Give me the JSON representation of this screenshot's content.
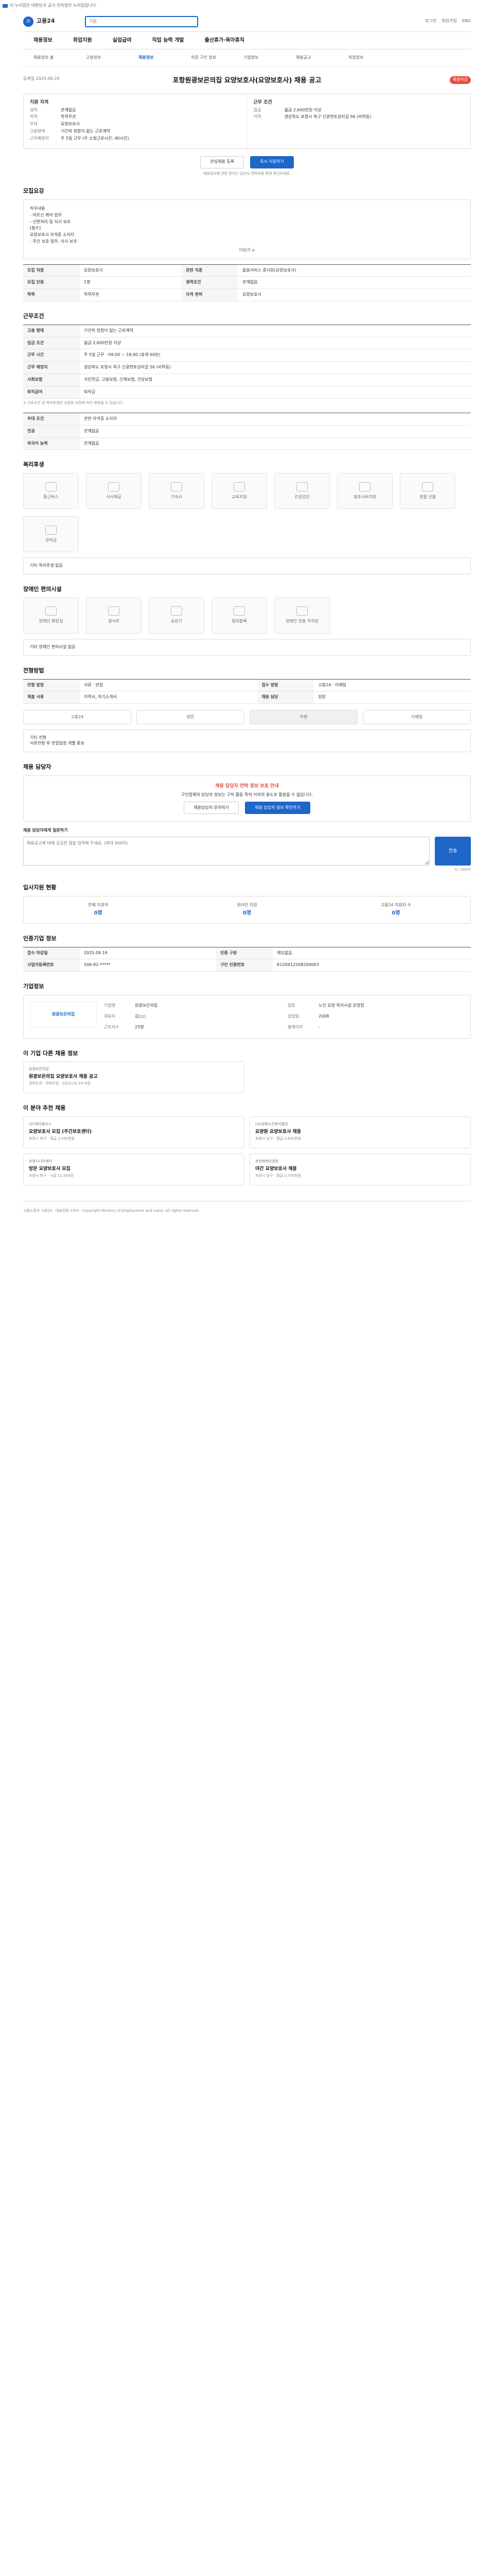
{
  "topbar": {
    "notice": "이 누리집은 대한민국 공식 전자정부 누리집입니다."
  },
  "brand": {
    "logo_text": "고용24",
    "search_placeholder": "기업",
    "util": [
      "로그인",
      "회원가입",
      "ENG"
    ]
  },
  "gnb": [
    "채용정보",
    "취업지원",
    "실업급여",
    "직업 능력 개발",
    "출산휴가·육아휴직"
  ],
  "sub": [
    "채용정보 홈",
    "고용정보",
    "채용정보",
    "직종 구인 정보",
    "기업정보",
    "채용공고",
    "직업정보"
  ],
  "job": {
    "title": "포항원광보은의집 요양보호사(요양보호사) 채용 공고",
    "registered": "등록일 2025.08.20",
    "badge": "채용마감",
    "recruit_title": "지원 자격",
    "work_title": "근무 조건",
    "recruit": [
      {
        "k": "경력",
        "v": "관계없음"
      },
      {
        "k": "학력",
        "v": "학력무관"
      },
      {
        "k": "우대",
        "v": "요양보호사"
      },
      {
        "k": "고용형태",
        "v": "기간의 정함이 없는 근로계약"
      },
      {
        "k": "근무예정지",
        "v": "주 5일 근무 (주 소정근로시간: 40시간)"
      }
    ],
    "work": [
      {
        "k": "임금",
        "v": "월급 2,600천원 이상"
      },
      {
        "k": "지역",
        "v": "경상북도 포항시 북구 신광면토성리길 56 (비학동)"
      }
    ],
    "apply_btn": "즉시 지원하기",
    "scrap_btn": "관심채용 등록",
    "hint": "채용정보에 관한 문의는 담당자 연락처를 통해 확인하세요."
  },
  "sections": {
    "detail": "모집요강",
    "work": "근무조건",
    "welfare": "복리후생",
    "disability": "장애인 편의시설",
    "process": "전형방법",
    "contact": "채용 담당자",
    "stats": "입사지원 현황",
    "recruit_info": "인증기업 정보",
    "company": "기업정보",
    "related": "이 기업 다른 채용 정보",
    "recommend": "이 분야 추천 채용"
  },
  "detail_box": [
    "직무내용",
    "- 어르신 케어 업무",
    "- 신변처리 및 식사 보조",
    "[필수]",
    "요양보호사 자격증 소지자",
    "- 주간 보호 업무, 식사 보조"
  ],
  "more_label": "더보기 ∨",
  "recruit_table": [
    {
      "k": "모집 직종",
      "v": "요양보호사"
    },
    {
      "k": "관련 직종",
      "v": "돌봄서비스 종사원(요양보호사)"
    },
    {
      "k": "모집 인원",
      "v": "1명"
    },
    {
      "k": "경력조건",
      "v": "관계없음"
    },
    {
      "k": "학력",
      "v": "학력무관"
    },
    {
      "k": "자격 면허",
      "v": "요양보호사"
    }
  ],
  "work_table": [
    {
      "k": "고용 형태",
      "v": "기간의 정함이 없는 근로계약"
    },
    {
      "k": "임금 조건",
      "v": "월급 2,600천원 이상"
    },
    {
      "k": "근무 시간",
      "v": "주 5일 근무 · 09:00 ~ 18:00 (휴게 60분)"
    },
    {
      "k": "근무 예정지",
      "v": "경상북도 포항시 북구 신광면토성리길 56 (비학동)"
    },
    {
      "k": "사회보험",
      "v": "국민연금, 고용보험, 산재보험, 건강보험"
    },
    {
      "k": "퇴직급여",
      "v": "퇴직금"
    }
  ],
  "work_note": "※ 근로조건 및 복리후생은 사업장 사정에 따라 변동될 수 있습니다.",
  "extra_table": [
    {
      "k": "우대 조건",
      "v": "관련 자격증 소지자"
    },
    {
      "k": "전공",
      "v": "관계없음"
    },
    {
      "k": "외국어 능력",
      "v": "관계없음"
    }
  ],
  "welfare_items": [
    "통근버스",
    "식사제공",
    "기숙사",
    "교육지원",
    "건강검진",
    "경조사비지원",
    "명절 선물",
    "상여금"
  ],
  "welfare_note": "기타 복리후생 없음",
  "disability_items": [
    "장애인 화장실",
    "경사로",
    "승강기",
    "점자블록",
    "장애인 전용 주차장"
  ],
  "disability_note": "기타 장애인 편의시설 없음",
  "process_table": [
    {
      "k": "전형 방법",
      "v": "서류 · 면접"
    },
    {
      "k": "접수 방법",
      "v": "고용24 · 이메일"
    },
    {
      "k": "제출 서류",
      "v": "이력서, 자기소개서"
    },
    {
      "k": "채용 담당",
      "v": "원장"
    }
  ],
  "apply_methods": [
    "고용24",
    "방문",
    "우편",
    "이메일"
  ],
  "apply_note": "기타 전형\n서류전형 후 면접일정 개별 통보",
  "contact": {
    "warn": "채용 담당자 연락 정보 보호 안내",
    "warn_desc": "구인업체의 담당자 정보는 구직 활동 목적 이외의 용도로 활용할 수 없습니다.",
    "btn1": "채용담당자 문의하기",
    "btn2": "채용 담당자 정보 확인하기",
    "inquiry_label": "채용 담당자에게 질문하기",
    "inquiry_placeholder": "채용공고에 대해 궁금한 점을 입력해 주세요. (최대 500자)",
    "send": "전송",
    "count": "0 / 500자"
  },
  "stats": [
    {
      "label": "전체 지원자",
      "value": "0명"
    },
    {
      "label": "온라인 지원",
      "value": "0명"
    },
    {
      "label": "고용24 지원자 수",
      "value": "0명"
    }
  ],
  "recruit_info_table": [
    {
      "k": "접수 마감일",
      "v": "2025.09.19"
    },
    {
      "k": "인증 구분",
      "v": "해당없음"
    },
    {
      "k": "사업자등록번호",
      "v": "506-82-*****"
    },
    {
      "k": "구인 인증번호",
      "v": "K120912508200003"
    }
  ],
  "company": {
    "logo_text": "원광보은의집",
    "info": [
      {
        "k": "기업명",
        "v": "원광보은의집"
      },
      {
        "k": "업종",
        "v": "노인 요양 복지시설 운영업"
      },
      {
        "k": "대표자",
        "v": "김○○"
      },
      {
        "k": "설립일",
        "v": "2008"
      },
      {
        "k": "근로자수",
        "v": "25명"
      },
      {
        "k": "홈페이지",
        "v": "-"
      }
    ]
  },
  "related_cards": [
    {
      "company": "원광보은의집",
      "title": "원광보은의집 요양보호사 채용 공고",
      "meta": "경력무관 · 학력무관 · 2025.09.19 마감"
    }
  ],
  "recommend_cards": [
    {
      "company": "(주)케어플러스",
      "title": "요양보호사 모집 (주간보호센터)",
      "meta": "포항시 북구 · 월급 2,500천원"
    },
    {
      "company": "(사)경북노인복지협회",
      "title": "요양원 요양보호사 채용",
      "meta": "포항시 남구 · 월급 2,600천원"
    },
    {
      "company": "포항시니어케어",
      "title": "방문 요양보호사 모집",
      "meta": "포항시 북구 · 시급 11,000원"
    },
    {
      "company": "포항행복요양원",
      "title": "야간 요양보호사 채용",
      "meta": "포항시 남구 · 월급 2,700천원"
    }
  ],
  "footer": {
    "text": "고용노동부 고용24 · 대표전화 1350 · Copyright Ministry of Employment and Labor. All rights reserved."
  }
}
